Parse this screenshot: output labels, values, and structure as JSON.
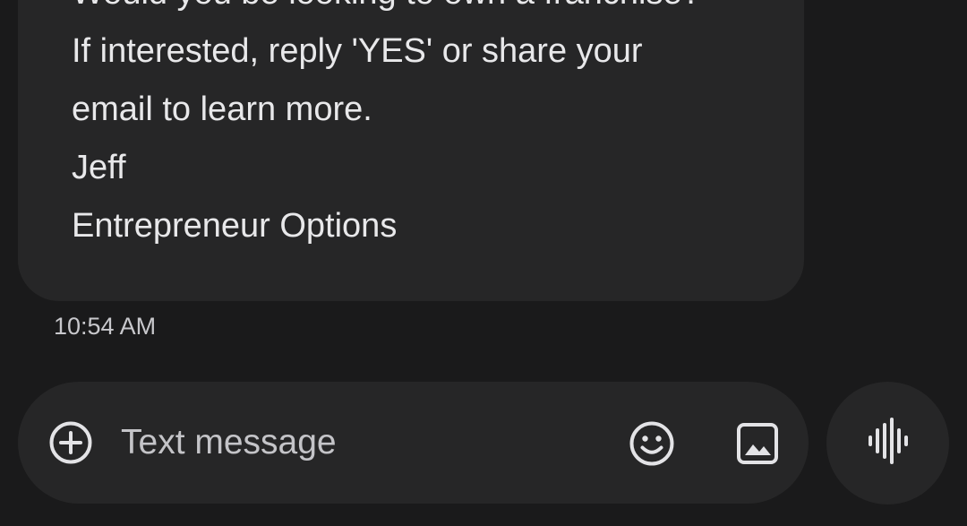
{
  "message": {
    "lines": [
      "Would you be looking to own a franchise?",
      "If interested, reply 'YES' or share your",
      "email to learn more.",
      "Jeff",
      "Entrepreneur Options"
    ],
    "timestamp": "10:54 AM"
  },
  "composer": {
    "placeholder": "Text message",
    "icons": {
      "attach": "plus-circle-icon",
      "emoji": "emoji-icon",
      "gallery": "image-icon",
      "voice": "voice-waveform-icon"
    }
  },
  "colors": {
    "background": "#1a1a1b",
    "bubble": "#262627",
    "text": "#e8e8ea",
    "icon": "#e3e3e6"
  }
}
